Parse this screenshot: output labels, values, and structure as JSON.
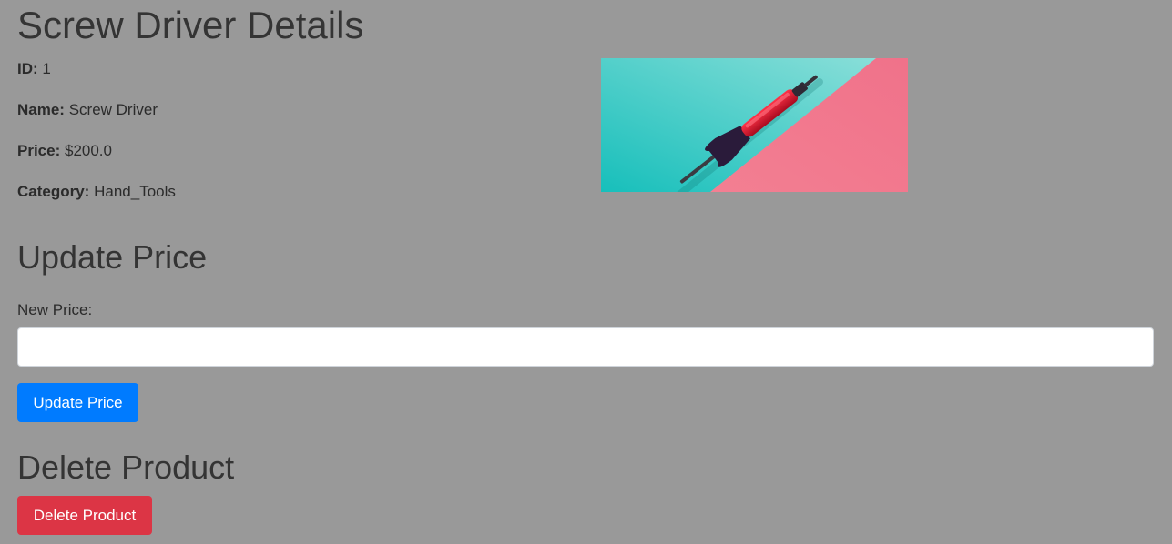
{
  "page": {
    "title": "Screw Driver Details"
  },
  "product": {
    "id_label": "ID:",
    "id_value": "1",
    "name_label": "Name:",
    "name_value": "Screw Driver",
    "price_label": "Price:",
    "price_value": "$200.0",
    "category_label": "Category:",
    "category_value": "Hand_Tools",
    "image_icon": "screwdriver-photo"
  },
  "update_section": {
    "title": "Update Price",
    "field_label": "New Price:",
    "input_value": "",
    "input_placeholder": "",
    "button_label": "Update Price"
  },
  "delete_section": {
    "title": "Delete Product",
    "button_label": "Delete Product"
  },
  "colors": {
    "page_background": "#999999",
    "primary_button": "#007bff",
    "danger_button": "#dc3545",
    "image_teal": "#28c7c2",
    "image_pink": "#f07c8f"
  }
}
